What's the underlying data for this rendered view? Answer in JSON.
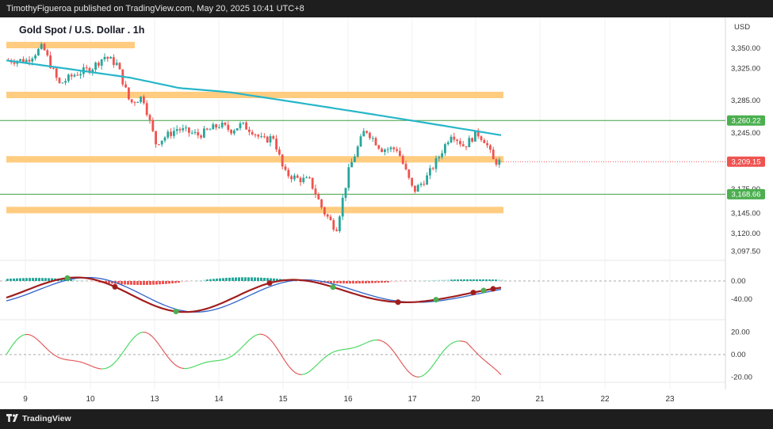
{
  "header": {
    "publisher_line": "TimothyFigueroa published on TradingView.com, May 20, 2025 10:41 UTC+8"
  },
  "footer": {
    "brand": "TradingView"
  },
  "colors": {
    "background": "#ffffff",
    "bull": "#26a69a",
    "bear": "#ef5350",
    "ma_line": "#27b6c9",
    "zone": "#ffcc80",
    "green_line": "#43a047",
    "current_price_tag": "#ef5350",
    "level_tag": "#4caf50",
    "macd_fast": "#2f63c9",
    "macd_rising": "#4caf50",
    "macd_falling": "#a11d1d",
    "osc_up": "#4cd964",
    "osc_down": "#e35b5b"
  },
  "chart_data": {
    "type": "candlestick",
    "title": "Gold Spot / U.S. Dollar . 1h",
    "currency": "USD",
    "y_ticks": [
      "3,350.00",
      "3,325.00",
      "3,285.00",
      "3,245.00",
      "3,175.00",
      "3,145.00",
      "3,120.00",
      "3,097.50"
    ],
    "x_ticks": [
      "9",
      "10",
      "13",
      "14",
      "15",
      "16",
      "17",
      "20",
      "21",
      "22",
      "23"
    ],
    "price_tags": [
      {
        "label": "3,260.22",
        "value": 3260.22,
        "kind": "level"
      },
      {
        "label": "3,209.15",
        "value": 3209.15,
        "kind": "current"
      },
      {
        "label": "3,168.66",
        "value": 3168.66,
        "kind": "level"
      }
    ],
    "zones": [
      {
        "low": 3350,
        "high": 3358,
        "x_from": "9",
        "x_to": "10"
      },
      {
        "low": 3288,
        "high": 3296,
        "x_from": "9",
        "x_to": "19"
      },
      {
        "low": 3208,
        "high": 3216,
        "x_from": "9",
        "x_to": "19"
      },
      {
        "low": 3145,
        "high": 3153,
        "x_from": "9",
        "x_to": "19"
      }
    ],
    "close_path": [
      [
        "9",
        3335
      ],
      [
        "9",
        3352
      ],
      [
        "9",
        3305
      ],
      [
        "9",
        3318
      ],
      [
        "10",
        3325
      ],
      [
        "10",
        3340
      ],
      [
        "10",
        3330
      ],
      [
        "10",
        3282
      ],
      [
        "10",
        3290
      ],
      [
        "13",
        3232
      ],
      [
        "13",
        3250
      ],
      [
        "13",
        3242
      ],
      [
        "14",
        3255
      ],
      [
        "14",
        3248
      ],
      [
        "14",
        3255
      ],
      [
        "14",
        3248
      ],
      [
        "14",
        3235
      ],
      [
        "14",
        3240
      ],
      [
        "15",
        3195
      ],
      [
        "15",
        3188
      ],
      [
        "15",
        3185
      ],
      [
        "15",
        3148
      ],
      [
        "15",
        3125
      ],
      [
        "16",
        3200
      ],
      [
        "16",
        3250
      ],
      [
        "16",
        3225
      ],
      [
        "16",
        3225
      ],
      [
        "17",
        3172
      ],
      [
        "17",
        3188
      ],
      [
        "17",
        3215
      ],
      [
        "17",
        3245
      ],
      [
        "17",
        3228
      ],
      [
        "20",
        3245
      ],
      [
        "20",
        3235
      ],
      [
        "20",
        3209.15
      ]
    ],
    "moving_average_range": [
      3335,
      3242
    ],
    "indicators": [
      {
        "name": "macd",
        "ticks": [
          "0.00",
          "-40.00"
        ]
      },
      {
        "name": "oscillator",
        "ticks": [
          "20.00",
          "0.00",
          "-20.00"
        ]
      }
    ]
  }
}
